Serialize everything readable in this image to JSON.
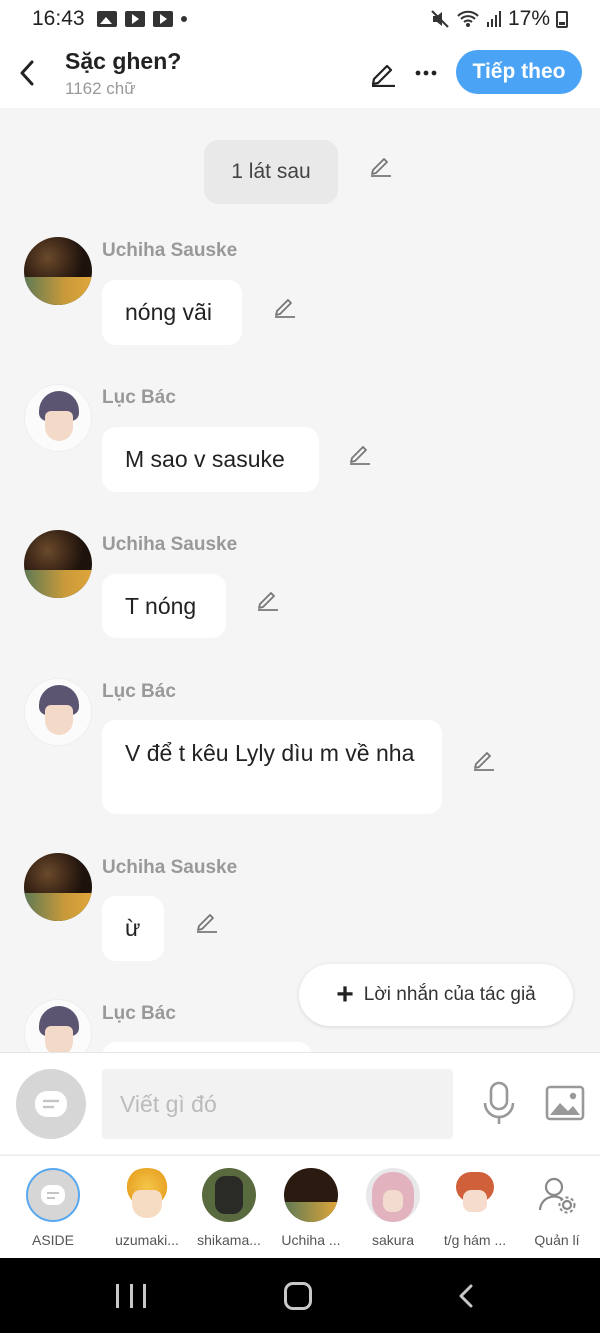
{
  "status_bar": {
    "time": "16:43",
    "battery": "17%"
  },
  "header": {
    "title": "Sặc ghen?",
    "subtitle": "1162 chữ",
    "next_label": "Tiếp theo"
  },
  "time_chip": "1 lát sau",
  "messages": [
    {
      "sender": "Uchiha Sauske",
      "text": "nóng vãi"
    },
    {
      "sender": "Lục Bác",
      "text": "M sao v sasuke"
    },
    {
      "sender": "Uchiha Sauske",
      "text": "T nóng"
    },
    {
      "sender": "Lục Bác",
      "text": "V để t kêu Lyly dìu m về nha"
    },
    {
      "sender": "Uchiha Sauske",
      "text": "ừ"
    },
    {
      "sender": "Lục Bác",
      "text": ""
    }
  ],
  "author_note_label": "Lời nhắn của tác giả",
  "composer": {
    "placeholder": "Viết gì đó"
  },
  "characters": [
    {
      "name": "ASIDE"
    },
    {
      "name": "uzumaki..."
    },
    {
      "name": "shikama..."
    },
    {
      "name": "Uchiha ..."
    },
    {
      "name": "sakura"
    },
    {
      "name": "t/g hám ..."
    },
    {
      "name": "Quản lí"
    }
  ],
  "colors": {
    "accent": "#4aa3f5",
    "background": "#f5f5f5",
    "bubble": "#ffffff"
  }
}
